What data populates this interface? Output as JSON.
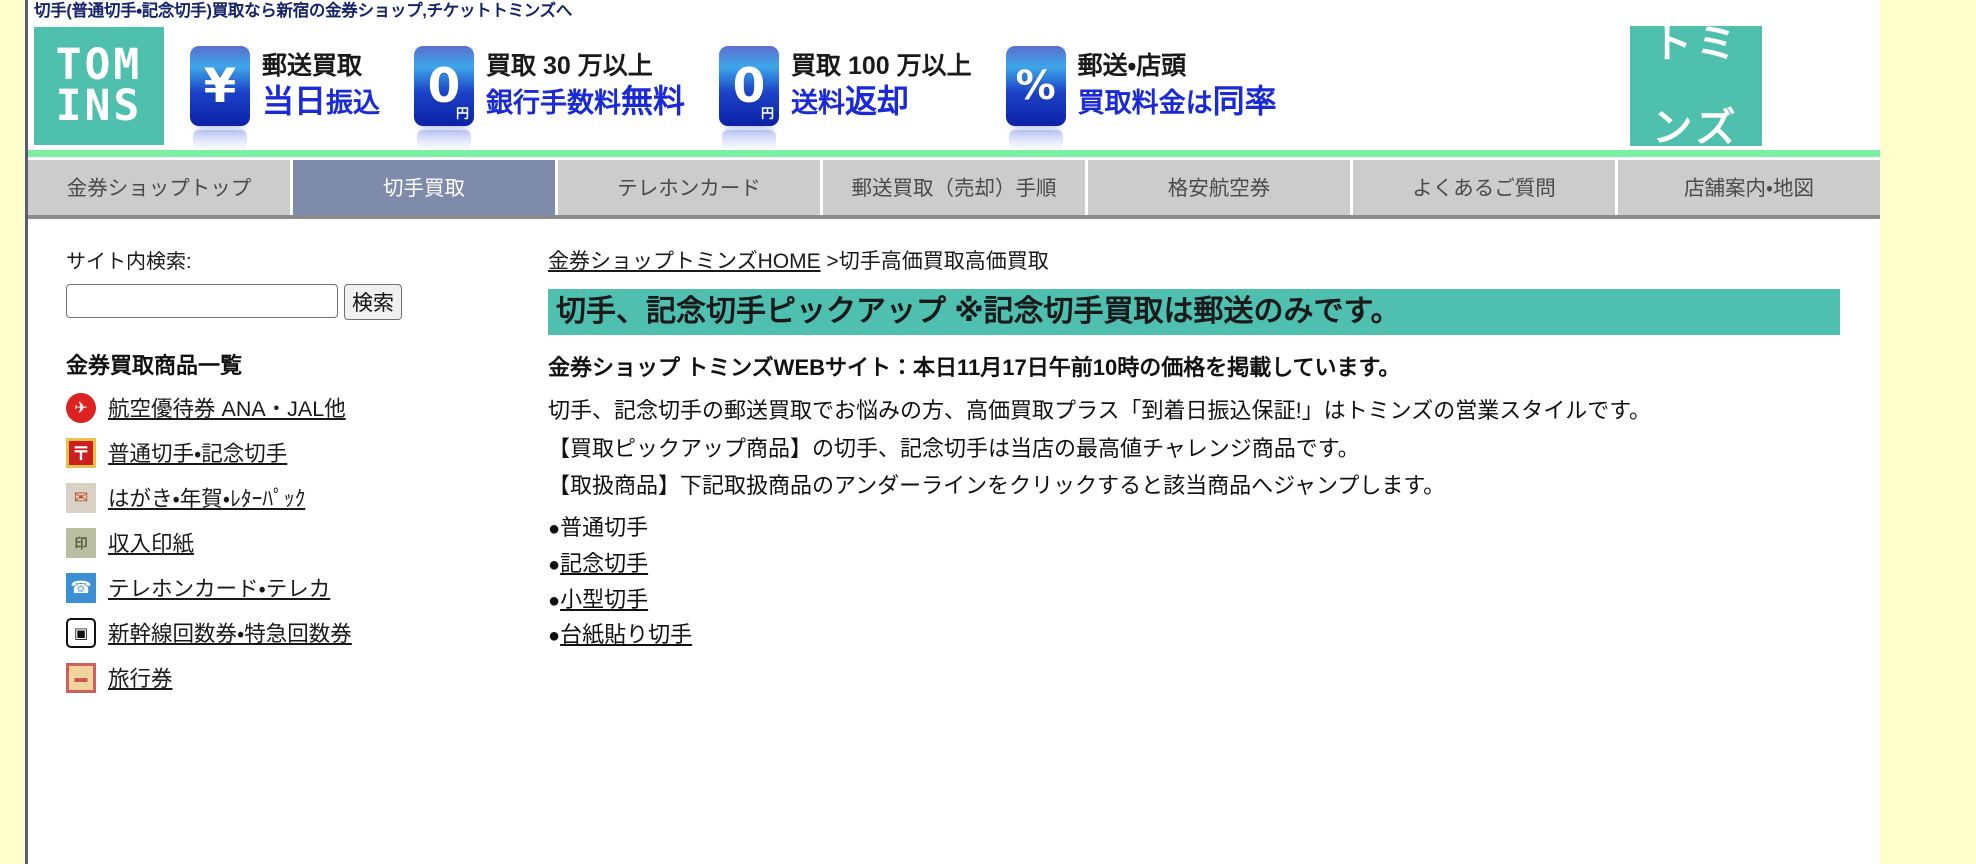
{
  "site": {
    "title": "切手(普通切手・記念切手)買取なら新宿の金券ショップ,チケットトミンズへ",
    "logo_line1": "TOM",
    "logo_line2": "INS",
    "logo_kana_line1": "トミ",
    "logo_kana_line2": "ンズ"
  },
  "banner": {
    "promos": [
      {
        "glyph": "¥",
        "unit": "",
        "line1": "郵送買取",
        "line2_plain": "当日",
        "line2_accent": "振込",
        "icon": "yen-chip-icon"
      },
      {
        "glyph": "0",
        "unit": "円",
        "line1": "買取 30 万以上",
        "line2_plain": "銀行手数料",
        "line2_accent": "無料",
        "icon": "zero-yen-chip-icon"
      },
      {
        "glyph": "0",
        "unit": "円",
        "line1": "買取 100 万以上",
        "line2_plain": "送料",
        "line2_accent": "返却",
        "icon": "zero-yen-chip-icon"
      },
      {
        "glyph": "%",
        "unit": "",
        "line1": "郵送・店頭",
        "line2_plain": "買取料金は",
        "line2_accent": "同率",
        "icon": "percent-chip-icon"
      }
    ]
  },
  "nav": {
    "tabs": [
      {
        "label": "金券ショップトップ",
        "active": false
      },
      {
        "label": "切手買取",
        "active": true
      },
      {
        "label": "テレホンカード",
        "active": false
      },
      {
        "label": "郵送買取（売却）手順",
        "active": false
      },
      {
        "label": "格安航空券",
        "active": false
      },
      {
        "label": "よくあるご質問",
        "active": false
      },
      {
        "label": "店舗案内・地図",
        "active": false
      }
    ]
  },
  "sidebar": {
    "search_label": "サイト内検索:",
    "search_value": "",
    "search_placeholder": "",
    "search_button": "検索",
    "products_heading": "金券買取商品一覧",
    "products": [
      {
        "label": "航空優待券 ANA・JAL他",
        "icon": "airline-ticket-icon",
        "glyph": "✈"
      },
      {
        "label": "普通切手・記念切手",
        "icon": "postal-mark-icon",
        "glyph": "〒"
      },
      {
        "label": "はがき・年賀・ﾚﾀｰﾊﾟｯｸ",
        "icon": "mailbox-icon",
        "glyph": "✉"
      },
      {
        "label": "収入印紙",
        "icon": "revenue-stamp-icon",
        "glyph": "印"
      },
      {
        "label": "テレホンカード・テレカ",
        "icon": "telephone-card-icon",
        "glyph": "☎"
      },
      {
        "label": "新幹線回数券・特急回数券",
        "icon": "shinkansen-icon",
        "glyph": "▣"
      },
      {
        "label": "旅行券",
        "icon": "travel-voucher-icon",
        "glyph": "▬"
      }
    ]
  },
  "main": {
    "breadcrumb_home": "金券ショップトミンズHOME",
    "breadcrumb_sep": " >",
    "breadcrumb_current": "切手高価買取高価買取",
    "heading": "切手、記念切手ピックアップ ※記念切手買取は郵送のみです。",
    "lead": "金券ショップ トミンズWEBサイト：本日11月17日午前10時の価格を掲載しています。",
    "paragraphs": [
      "切手、記念切手の郵送買取でお悩みの方、高価買取プラス「到着日振込保証!」はトミンズの営業スタイルです。",
      "【買取ピックアップ商品】の切手、記念切手は当店の最高値チャレンジ商品です。",
      "【取扱商品】下記取扱商品のアンダーラインをクリックすると該当商品へジャンプします。"
    ],
    "bullets": [
      {
        "dot": "●",
        "label": "普通切手",
        "linked": false
      },
      {
        "dot": "●",
        "label": "記念切手",
        "linked": true
      },
      {
        "dot": "●",
        "label": "小型切手",
        "linked": true
      },
      {
        "dot": "●",
        "label": "台紙貼り切手",
        "linked": true
      }
    ]
  },
  "colors": {
    "page_background": "#ffffcc",
    "brand_teal": "#4fbfae",
    "nav_green": "#7cf0a2",
    "nav_tab": "#cccccc",
    "nav_tab_active": "#7f8baa",
    "heading_band": "#4fc0b0",
    "title_text": "#16236b",
    "promo_accent": "#1a2ad6"
  }
}
